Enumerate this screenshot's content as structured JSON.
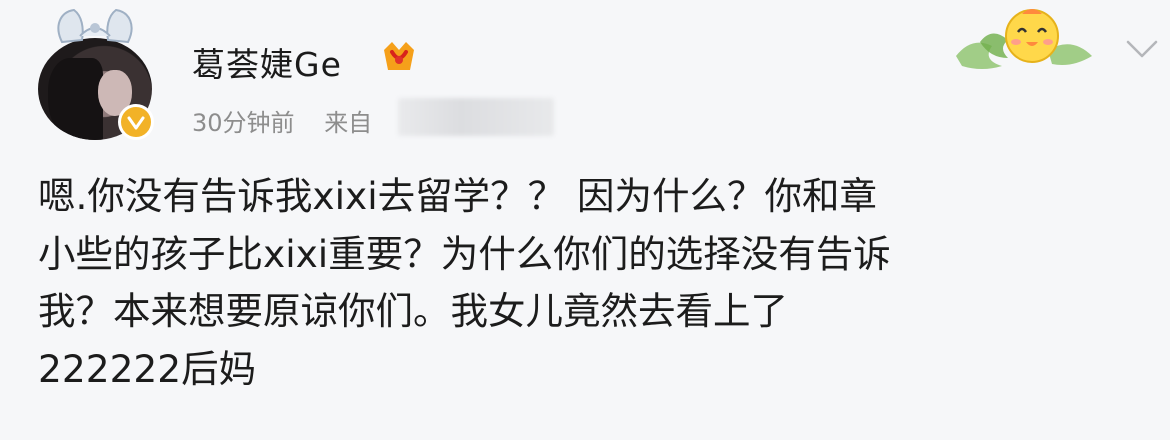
{
  "post": {
    "username": "葛荟婕Ge",
    "timestamp": "30分钟前",
    "source_label": "来自",
    "content_lines": [
      "嗯.你没有告诉我xixi去留学？？ 因为什么？你和章",
      "小些的孩子比xixi重要？为什么你们的选择没有告诉",
      "我？本来想要原谅你们。我女儿竟然去看上了",
      "222222后妈"
    ]
  },
  "icons": {
    "verified": "verified-badge-icon",
    "member": "member-crown-icon",
    "sticker": "chick-sticker-icon",
    "expand": "chevron-down-icon"
  },
  "colors": {
    "background": "#f6f7f9",
    "username": "#1b1b1b",
    "meta": "#8d8d8d",
    "verified": "#f2b227",
    "member": "#f5a01a"
  }
}
